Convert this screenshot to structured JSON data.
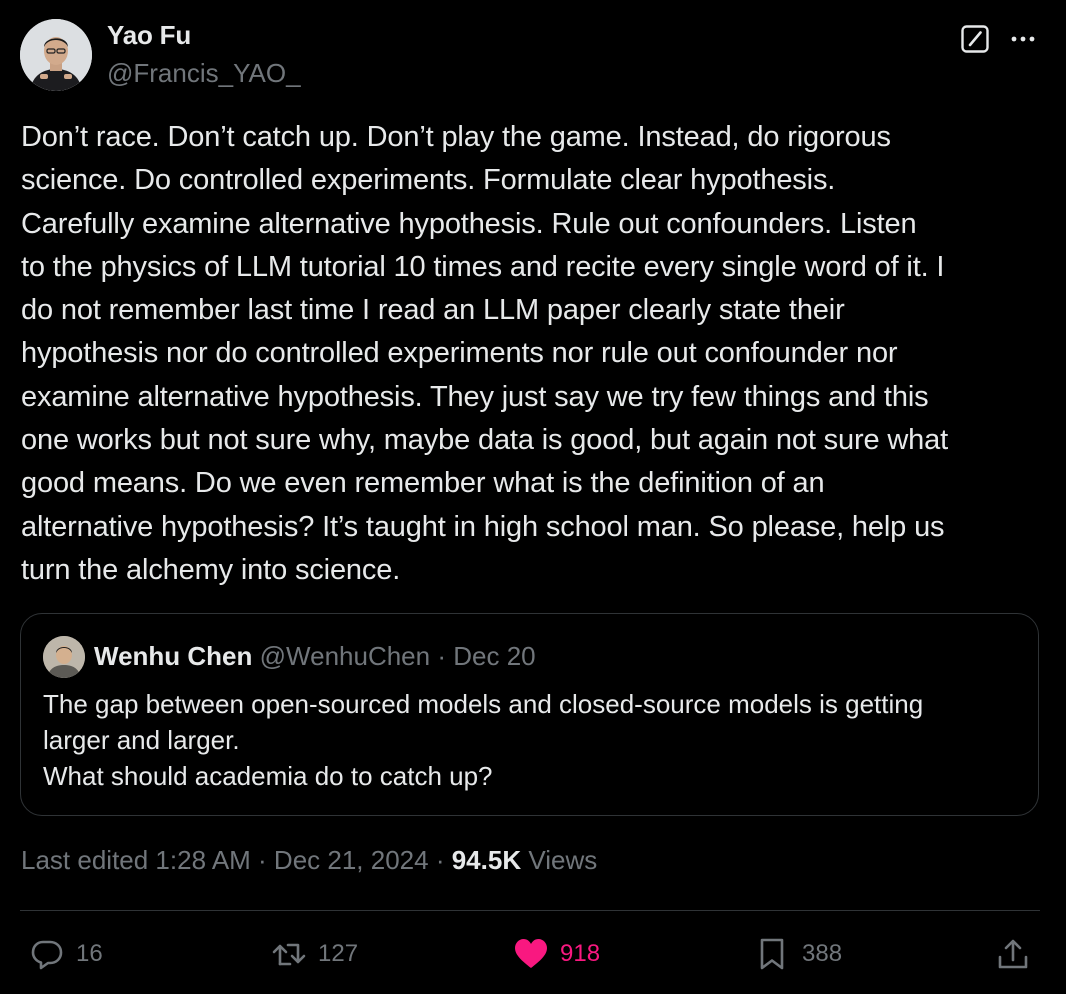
{
  "author": {
    "name": "Yao Fu",
    "handle": "@Francis_YAO_"
  },
  "tweet_text": "Don’t race. Don’t catch up. Don’t play the game. Instead, do rigorous\nscience. Do controlled experiments. Formulate clear hypothesis.\nCarefully examine alternative hypothesis. Rule out confounders. Listen\nto the physics of LLM tutorial 10 times and recite every single word of it. I\ndo not remember last time I read an LLM paper clearly state their\nhypothesis nor do controlled experiments nor rule out confounder nor\nexamine alternative hypothesis. They just say we try few things and this\none works but not sure why, maybe data is good, but again not sure what\ngood means. Do we even remember what is the definition of an\nalternative hypothesis? It’s taught in high school man. So please, help us\nturn the alchemy into science.",
  "quote": {
    "name": "Wenhu Chen",
    "handle": "@WenhuChen",
    "separator": "·",
    "date": "Dec 20",
    "text": "The gap between open-sourced models and closed-source models is getting\nlarger and larger.\nWhat should academia do to catch up?"
  },
  "meta": {
    "edited_label": "Last edited 1:28 AM · Dec 21, 2024 ·",
    "views_count": "94.5K",
    "views_label": "Views"
  },
  "actions": {
    "replies": "16",
    "reposts": "127",
    "likes": "918",
    "bookmarks": "388"
  },
  "icons": [
    "grok-icon",
    "more-icon",
    "reply-icon",
    "repost-icon",
    "like-icon",
    "bookmark-icon",
    "share-icon"
  ],
  "colors": {
    "background": "#000000",
    "text": "#e7e9ea",
    "secondary": "#71767b",
    "like": "#f91880",
    "border": "#2f3336"
  }
}
